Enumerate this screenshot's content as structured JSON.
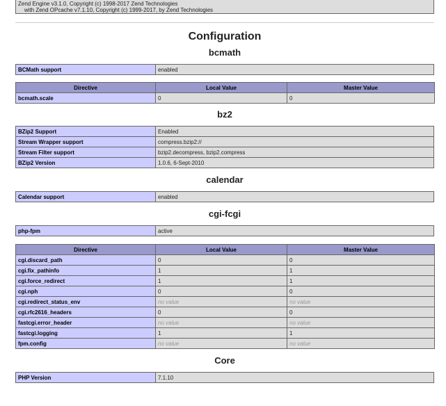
{
  "engine": {
    "line1": "Zend Engine v3.1.0, Copyright (c) 1998-2017 Zend Technologies",
    "line2": "    with Zend OPcache v7.1.10, Copyright (c) 1999-2017, by Zend Technologies"
  },
  "page_title": "Configuration",
  "headers": {
    "directive": "Directive",
    "local": "Local Value",
    "master": "Master Value"
  },
  "bcmath": {
    "title": "bcmath",
    "info": [
      {
        "name": "BCMath support",
        "value": "enabled"
      }
    ],
    "directives": [
      {
        "name": "bcmath.scale",
        "local": "0",
        "master": "0"
      }
    ]
  },
  "bz2": {
    "title": "bz2",
    "info": [
      {
        "name": "BZip2 Support",
        "value": "Enabled"
      },
      {
        "name": "Stream Wrapper support",
        "value": "compress.bzip2://"
      },
      {
        "name": "Stream Filter support",
        "value": "bzip2.decompress, bzip2.compress"
      },
      {
        "name": "BZip2 Version",
        "value": "1.0.6, 6-Sept-2010"
      }
    ]
  },
  "calendar": {
    "title": "calendar",
    "info": [
      {
        "name": "Calendar support",
        "value": "enabled"
      }
    ]
  },
  "cgi_fcgi": {
    "title": "cgi-fcgi",
    "info": [
      {
        "name": "php-fpm",
        "value": "active"
      }
    ],
    "directives": [
      {
        "name": "cgi.discard_path",
        "local": "0",
        "master": "0"
      },
      {
        "name": "cgi.fix_pathinfo",
        "local": "1",
        "master": "1"
      },
      {
        "name": "cgi.force_redirect",
        "local": "1",
        "master": "1"
      },
      {
        "name": "cgi.nph",
        "local": "0",
        "master": "0"
      },
      {
        "name": "cgi.redirect_status_env",
        "local": "no value",
        "master": "no value"
      },
      {
        "name": "cgi.rfc2616_headers",
        "local": "0",
        "master": "0"
      },
      {
        "name": "fastcgi.error_header",
        "local": "no value",
        "master": "no value"
      },
      {
        "name": "fastcgi.logging",
        "local": "1",
        "master": "1"
      },
      {
        "name": "fpm.config",
        "local": "no value",
        "master": "no value"
      }
    ]
  },
  "core": {
    "title": "Core",
    "info": [
      {
        "name": "PHP Version",
        "value": "7.1.10"
      }
    ]
  }
}
